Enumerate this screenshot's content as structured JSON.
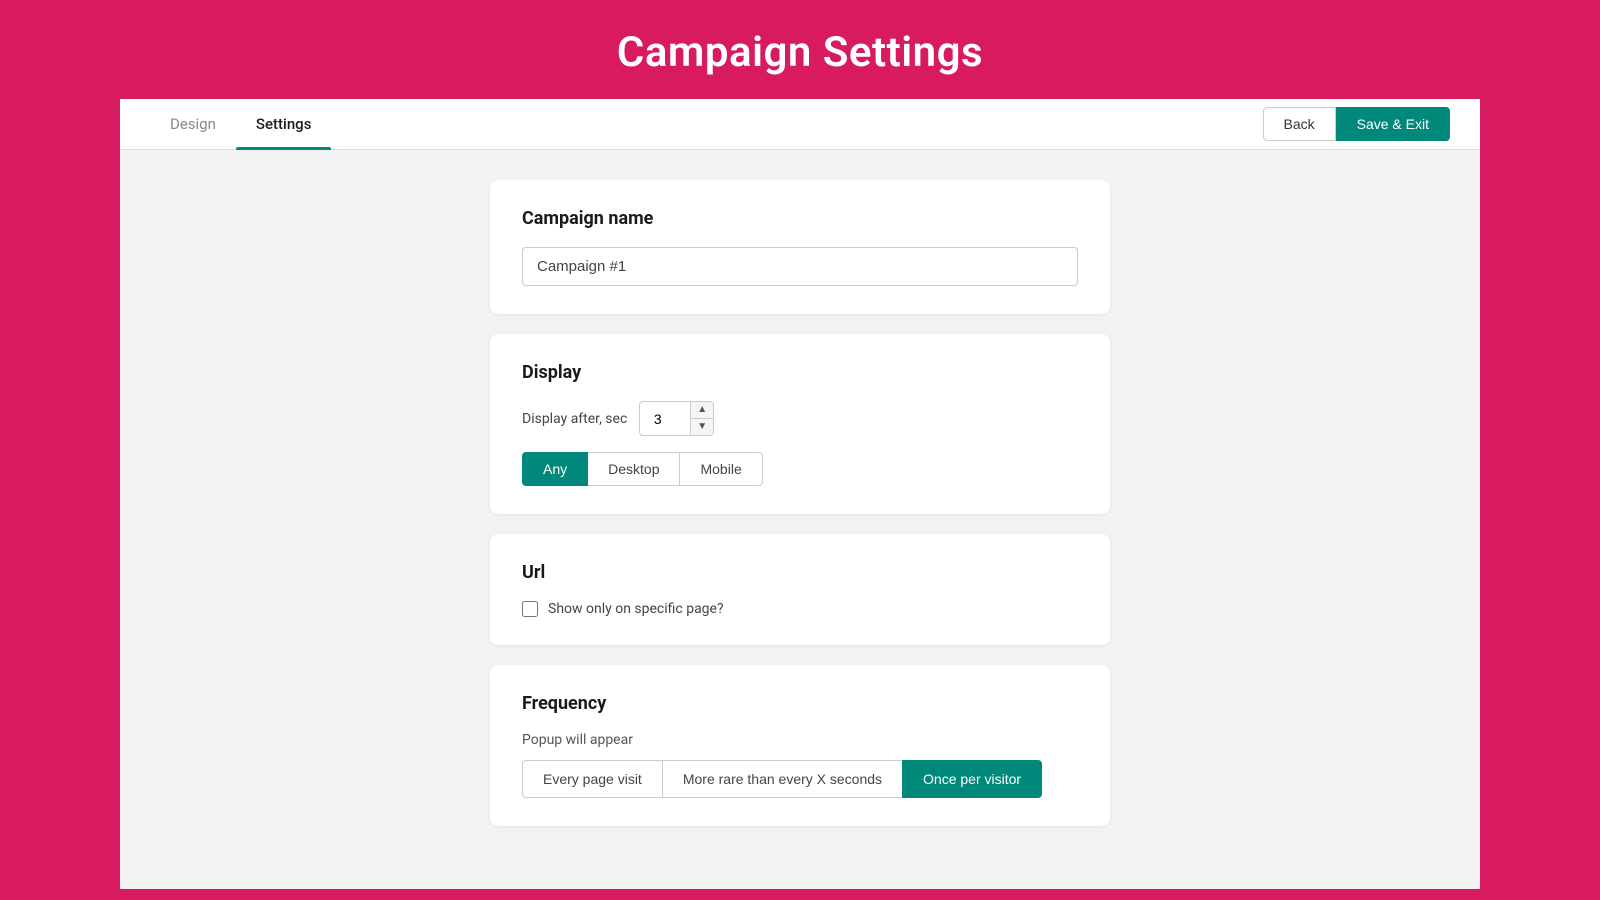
{
  "header": {
    "title": "Campaign Settings"
  },
  "tabs": {
    "design_label": "Design",
    "settings_label": "Settings",
    "back_label": "Back",
    "save_exit_label": "Save & Exit"
  },
  "campaign_name_card": {
    "title": "Campaign name",
    "input_value": "Campaign #1",
    "input_placeholder": "Campaign #1"
  },
  "display_card": {
    "title": "Display",
    "display_after_label": "Display after, sec",
    "display_after_value": "3",
    "device_buttons": [
      {
        "label": "Any",
        "active": true
      },
      {
        "label": "Desktop",
        "active": false
      },
      {
        "label": "Mobile",
        "active": false
      }
    ]
  },
  "url_card": {
    "title": "Url",
    "checkbox_checked": false,
    "checkbox_label": "Show only on specific page?"
  },
  "frequency_card": {
    "title": "Frequency",
    "popup_will_appear_label": "Popup will appear",
    "frequency_buttons": [
      {
        "label": "Every page visit",
        "active": false
      },
      {
        "label": "More rare than every X seconds",
        "active": false
      },
      {
        "label": "Once per visitor",
        "active": true
      }
    ]
  },
  "colors": {
    "primary": "#d81b60",
    "accent": "#00897b",
    "white": "#ffffff"
  }
}
